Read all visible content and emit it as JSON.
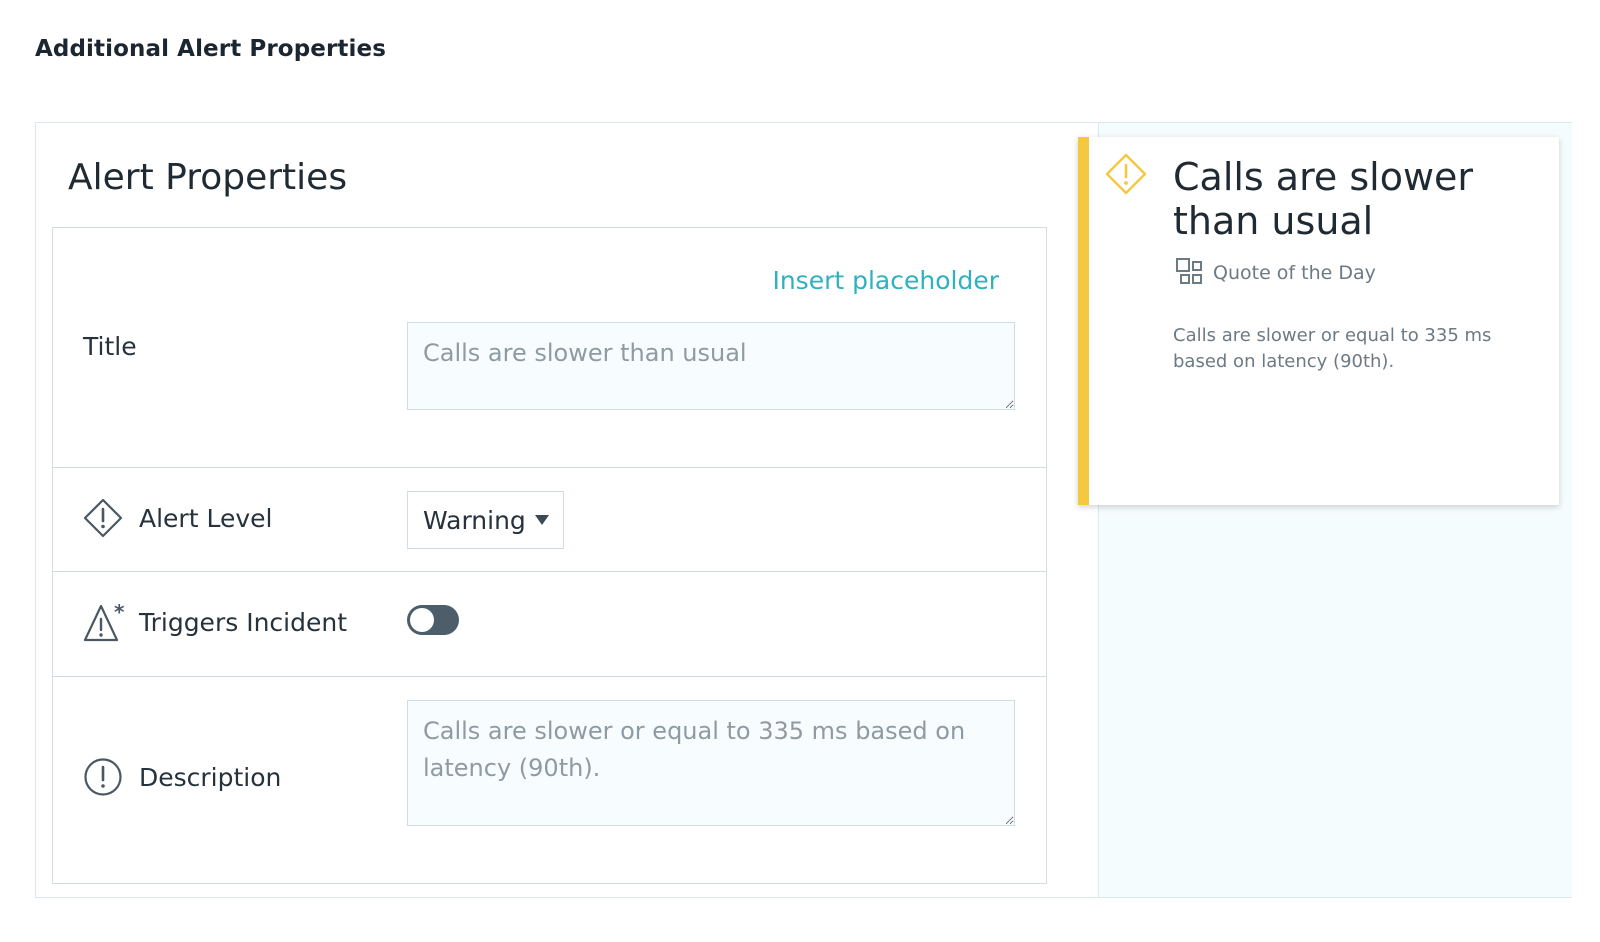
{
  "section_heading": "Additional Alert Properties",
  "form": {
    "title": "Alert Properties",
    "insert_placeholder_label": "Insert placeholder",
    "title_row": {
      "label": "Title",
      "placeholder": "Calls are slower than usual"
    },
    "alert_level_row": {
      "label": "Alert Level",
      "icon": "warning-diamond-icon",
      "selected": "Warning"
    },
    "incident_row": {
      "label": "Triggers Incident",
      "icon": "incident-triangle-icon",
      "enabled": false
    },
    "description_row": {
      "label": "Description",
      "icon": "exclamation-circle-icon",
      "placeholder": "Calls are slower or equal to 335 ms based on latency (90th)."
    }
  },
  "preview": {
    "title": "Calls are slower than usual",
    "source_icon": "dashboard-icon",
    "source": "Quote of the Day",
    "description": "Calls are slower or equal to 335 ms based on latency (90th).",
    "accent_color": "#f5c842",
    "warning_icon_color": "#f5c842"
  },
  "colors": {
    "link": "#2fb1bf",
    "toggle_off": "#4d5d69",
    "preview_background": "#f5fcfd"
  }
}
